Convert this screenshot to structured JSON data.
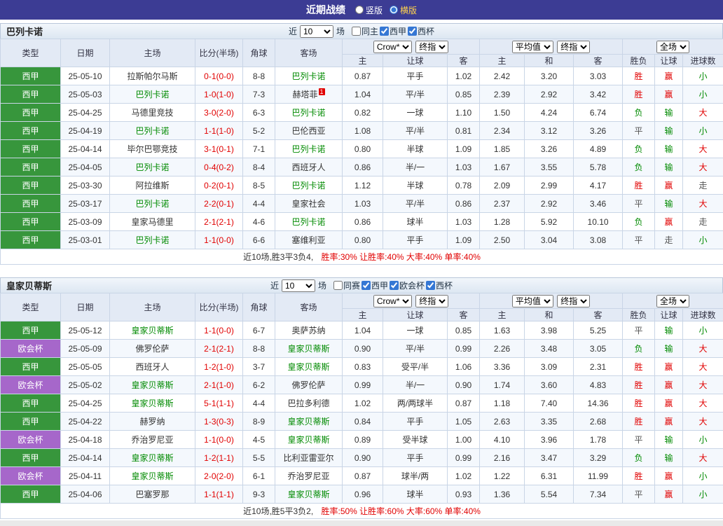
{
  "topbar": {
    "title": "近期战绩",
    "options": [
      {
        "label": "竖版",
        "selected": false
      },
      {
        "label": "横版",
        "selected": true
      }
    ]
  },
  "head": {
    "cols": [
      "类型",
      "日期",
      "主场",
      "比分(半场)",
      "角球",
      "客场"
    ],
    "odds_sub": [
      "主",
      "让球",
      "客"
    ],
    "avg_sub": [
      "主",
      "和",
      "客"
    ],
    "result_sub": [
      "胜负",
      "让球",
      "进球数"
    ]
  },
  "colors": {
    "liga_badge": "#37963c",
    "uecl_badge": "#a667ca",
    "win_red": "#e10000",
    "loss_green": "#008a00",
    "push_gray": "#555555",
    "focus_team_green": "#008a00",
    "topbar_purple": "#3c3c94"
  },
  "sections": [
    {
      "team": "巴列卡诺",
      "controls": {
        "near_label": "近",
        "count": "10",
        "unit_label": "场"
      },
      "filters": [
        {
          "label": "同主",
          "checked": false
        },
        {
          "label": "西甲",
          "checked": true
        },
        {
          "label": "西杯",
          "checked": true
        }
      ],
      "selects": {
        "book": "Crow*",
        "book_final": "终指",
        "avg": "平均值",
        "avg_final": "终指",
        "scope": "全场"
      },
      "rows": [
        {
          "league": "西甲",
          "lc": "liga",
          "date": "25-05-10",
          "home": "拉斯帕尔马斯",
          "hf": false,
          "score": "0-1(0-0)",
          "corner": "8-8",
          "away": "巴列卡诺",
          "af": true,
          "o1": "0.87",
          "hcp": "平手",
          "o2": "1.02",
          "a1": "2.42",
          "a2": "3.20",
          "a3": "3.03",
          "r1": "胜",
          "c1": "red",
          "r2": "赢",
          "c2": "red",
          "r3": "小",
          "c3": "green"
        },
        {
          "league": "西甲",
          "lc": "liga",
          "date": "25-05-03",
          "home": "巴列卡诺",
          "hf": true,
          "score": "1-0(1-0)",
          "corner": "7-3",
          "away": "赫塔菲",
          "af": false,
          "badge": "1",
          "o1": "1.04",
          "hcp": "平/半",
          "o2": "0.85",
          "a1": "2.39",
          "a2": "2.92",
          "a3": "3.42",
          "r1": "胜",
          "c1": "red",
          "r2": "赢",
          "c2": "red",
          "r3": "小",
          "c3": "green"
        },
        {
          "league": "西甲",
          "lc": "liga",
          "date": "25-04-25",
          "home": "马德里竞技",
          "hf": false,
          "score": "3-0(2-0)",
          "corner": "6-3",
          "away": "巴列卡诺",
          "af": true,
          "o1": "0.82",
          "hcp": "一球",
          "o2": "1.10",
          "a1": "1.50",
          "a2": "4.24",
          "a3": "6.74",
          "r1": "负",
          "c1": "green",
          "r2": "输",
          "c2": "green",
          "r3": "大",
          "c3": "red"
        },
        {
          "league": "西甲",
          "lc": "liga",
          "date": "25-04-19",
          "home": "巴列卡诺",
          "hf": true,
          "score": "1-1(1-0)",
          "corner": "5-2",
          "away": "巴伦西亚",
          "af": false,
          "o1": "1.08",
          "hcp": "平/半",
          "o2": "0.81",
          "a1": "2.34",
          "a2": "3.12",
          "a3": "3.26",
          "r1": "平",
          "c1": "gray",
          "r2": "输",
          "c2": "green",
          "r3": "小",
          "c3": "green"
        },
        {
          "league": "西甲",
          "lc": "liga",
          "date": "25-04-14",
          "home": "毕尔巴鄂竞技",
          "hf": false,
          "score": "3-1(0-1)",
          "corner": "7-1",
          "away": "巴列卡诺",
          "af": true,
          "o1": "0.80",
          "hcp": "半球",
          "o2": "1.09",
          "a1": "1.85",
          "a2": "3.26",
          "a3": "4.89",
          "r1": "负",
          "c1": "green",
          "r2": "输",
          "c2": "green",
          "r3": "大",
          "c3": "red"
        },
        {
          "league": "西甲",
          "lc": "liga",
          "date": "25-04-05",
          "home": "巴列卡诺",
          "hf": true,
          "score": "0-4(0-2)",
          "corner": "8-4",
          "away": "西班牙人",
          "af": false,
          "o1": "0.86",
          "hcp": "半/一",
          "o2": "1.03",
          "a1": "1.67",
          "a2": "3.55",
          "a3": "5.78",
          "r1": "负",
          "c1": "green",
          "r2": "输",
          "c2": "green",
          "r3": "大",
          "c3": "red"
        },
        {
          "league": "西甲",
          "lc": "liga",
          "date": "25-03-30",
          "home": "阿拉维斯",
          "hf": false,
          "score": "0-2(0-1)",
          "corner": "8-5",
          "away": "巴列卡诺",
          "af": true,
          "o1": "1.12",
          "hcp": "半球",
          "o2": "0.78",
          "a1": "2.09",
          "a2": "2.99",
          "a3": "4.17",
          "r1": "胜",
          "c1": "red",
          "r2": "赢",
          "c2": "red",
          "r3": "走",
          "c3": "gray"
        },
        {
          "league": "西甲",
          "lc": "liga",
          "date": "25-03-17",
          "home": "巴列卡诺",
          "hf": true,
          "score": "2-2(0-1)",
          "corner": "4-4",
          "away": "皇家社会",
          "af": false,
          "o1": "1.03",
          "hcp": "平/半",
          "o2": "0.86",
          "a1": "2.37",
          "a2": "2.92",
          "a3": "3.46",
          "r1": "平",
          "c1": "gray",
          "r2": "输",
          "c2": "green",
          "r3": "大",
          "c3": "red"
        },
        {
          "league": "西甲",
          "lc": "liga",
          "date": "25-03-09",
          "home": "皇家马德里",
          "hf": false,
          "score": "2-1(2-1)",
          "corner": "4-6",
          "away": "巴列卡诺",
          "af": true,
          "o1": "0.86",
          "hcp": "球半",
          "o2": "1.03",
          "a1": "1.28",
          "a2": "5.92",
          "a3": "10.10",
          "r1": "负",
          "c1": "green",
          "r2": "赢",
          "c2": "red",
          "r3": "走",
          "c3": "gray"
        },
        {
          "league": "西甲",
          "lc": "liga",
          "date": "25-03-01",
          "home": "巴列卡诺",
          "hf": true,
          "score": "1-1(0-0)",
          "corner": "6-6",
          "away": "塞维利亚",
          "af": false,
          "o1": "0.80",
          "hcp": "平手",
          "o2": "1.09",
          "a1": "2.50",
          "a2": "3.04",
          "a3": "3.08",
          "r1": "平",
          "c1": "gray",
          "r2": "走",
          "c2": "gray",
          "r3": "小",
          "c3": "green"
        }
      ],
      "summary": {
        "prefix": "近10场,胜3平3负4,",
        "rates": "胜率:30% 让胜率:40% 大率:40% 单率:40%"
      }
    },
    {
      "team": "皇家贝蒂斯",
      "controls": {
        "near_label": "近",
        "count": "10",
        "unit_label": "场"
      },
      "filters": [
        {
          "label": "同赛",
          "checked": false
        },
        {
          "label": "西甲",
          "checked": true
        },
        {
          "label": "欧会杯",
          "checked": true
        },
        {
          "label": "西杯",
          "checked": true
        }
      ],
      "selects": {
        "book": "Crow*",
        "book_final": "终指",
        "avg": "平均值",
        "avg_final": "终指",
        "scope": "全场"
      },
      "rows": [
        {
          "league": "西甲",
          "lc": "liga",
          "date": "25-05-12",
          "home": "皇家贝蒂斯",
          "hf": true,
          "score": "1-1(0-0)",
          "corner": "6-7",
          "away": "奥萨苏纳",
          "af": false,
          "o1": "1.04",
          "hcp": "一球",
          "o2": "0.85",
          "a1": "1.63",
          "a2": "3.98",
          "a3": "5.25",
          "r1": "平",
          "c1": "gray",
          "r2": "输",
          "c2": "green",
          "r3": "小",
          "c3": "green"
        },
        {
          "league": "欧会杯",
          "lc": "uecl",
          "date": "25-05-09",
          "home": "佛罗伦萨",
          "hf": false,
          "score": "2-1(2-1)",
          "corner": "8-8",
          "away": "皇家贝蒂斯",
          "af": true,
          "o1": "0.90",
          "hcp": "平/半",
          "o2": "0.99",
          "a1": "2.26",
          "a2": "3.48",
          "a3": "3.05",
          "r1": "负",
          "c1": "green",
          "r2": "输",
          "c2": "green",
          "r3": "大",
          "c3": "red"
        },
        {
          "league": "西甲",
          "lc": "liga",
          "date": "25-05-05",
          "home": "西班牙人",
          "hf": false,
          "score": "1-2(1-0)",
          "corner": "3-7",
          "away": "皇家贝蒂斯",
          "af": true,
          "o1": "0.83",
          "hcp": "受平/半",
          "o2": "1.06",
          "a1": "3.36",
          "a2": "3.09",
          "a3": "2.31",
          "r1": "胜",
          "c1": "red",
          "r2": "赢",
          "c2": "red",
          "r3": "大",
          "c3": "red"
        },
        {
          "league": "欧会杯",
          "lc": "uecl",
          "date": "25-05-02",
          "home": "皇家贝蒂斯",
          "hf": true,
          "score": "2-1(1-0)",
          "corner": "6-2",
          "away": "佛罗伦萨",
          "af": false,
          "o1": "0.99",
          "hcp": "半/一",
          "o2": "0.90",
          "a1": "1.74",
          "a2": "3.60",
          "a3": "4.83",
          "r1": "胜",
          "c1": "red",
          "r2": "赢",
          "c2": "red",
          "r3": "大",
          "c3": "red"
        },
        {
          "league": "西甲",
          "lc": "liga",
          "date": "25-04-25",
          "home": "皇家贝蒂斯",
          "hf": true,
          "score": "5-1(1-1)",
          "corner": "4-4",
          "away": "巴拉多利德",
          "af": false,
          "o1": "1.02",
          "hcp": "两/两球半",
          "o2": "0.87",
          "a1": "1.18",
          "a2": "7.40",
          "a3": "14.36",
          "r1": "胜",
          "c1": "red",
          "r2": "赢",
          "c2": "red",
          "r3": "大",
          "c3": "red"
        },
        {
          "league": "西甲",
          "lc": "liga",
          "date": "25-04-22",
          "home": "赫罗纳",
          "hf": false,
          "score": "1-3(0-3)",
          "corner": "8-9",
          "away": "皇家贝蒂斯",
          "af": true,
          "o1": "0.84",
          "hcp": "平手",
          "o2": "1.05",
          "a1": "2.63",
          "a2": "3.35",
          "a3": "2.68",
          "r1": "胜",
          "c1": "red",
          "r2": "赢",
          "c2": "red",
          "r3": "大",
          "c3": "red"
        },
        {
          "league": "欧会杯",
          "lc": "uecl",
          "date": "25-04-18",
          "home": "乔治罗尼亚",
          "hf": false,
          "score": "1-1(0-0)",
          "corner": "4-5",
          "away": "皇家贝蒂斯",
          "af": true,
          "o1": "0.89",
          "hcp": "受半球",
          "o2": "1.00",
          "a1": "4.10",
          "a2": "3.96",
          "a3": "1.78",
          "r1": "平",
          "c1": "gray",
          "r2": "输",
          "c2": "green",
          "r3": "小",
          "c3": "green"
        },
        {
          "league": "西甲",
          "lc": "liga",
          "date": "25-04-14",
          "home": "皇家贝蒂斯",
          "hf": true,
          "score": "1-2(1-1)",
          "corner": "5-5",
          "away": "比利亚雷亚尔",
          "af": false,
          "o1": "0.90",
          "hcp": "平手",
          "o2": "0.99",
          "a1": "2.16",
          "a2": "3.47",
          "a3": "3.29",
          "r1": "负",
          "c1": "green",
          "r2": "输",
          "c2": "green",
          "r3": "大",
          "c3": "red"
        },
        {
          "league": "欧会杯",
          "lc": "uecl",
          "date": "25-04-11",
          "home": "皇家贝蒂斯",
          "hf": true,
          "score": "2-0(2-0)",
          "corner": "6-1",
          "away": "乔治罗尼亚",
          "af": false,
          "o1": "0.87",
          "hcp": "球半/两",
          "o2": "1.02",
          "a1": "1.22",
          "a2": "6.31",
          "a3": "11.99",
          "r1": "胜",
          "c1": "red",
          "r2": "赢",
          "c2": "red",
          "r3": "小",
          "c3": "green"
        },
        {
          "league": "西甲",
          "lc": "liga",
          "date": "25-04-06",
          "home": "巴塞罗那",
          "hf": false,
          "score": "1-1(1-1)",
          "corner": "9-3",
          "away": "皇家贝蒂斯",
          "af": true,
          "o1": "0.96",
          "hcp": "球半",
          "o2": "0.93",
          "a1": "1.36",
          "a2": "5.54",
          "a3": "7.34",
          "r1": "平",
          "c1": "gray",
          "r2": "赢",
          "c2": "red",
          "r3": "小",
          "c3": "green"
        }
      ],
      "summary": {
        "prefix": "近10场,胜5平3负2,",
        "rates": "胜率:50% 让胜率:60% 大率:60% 单率:40%"
      }
    }
  ]
}
